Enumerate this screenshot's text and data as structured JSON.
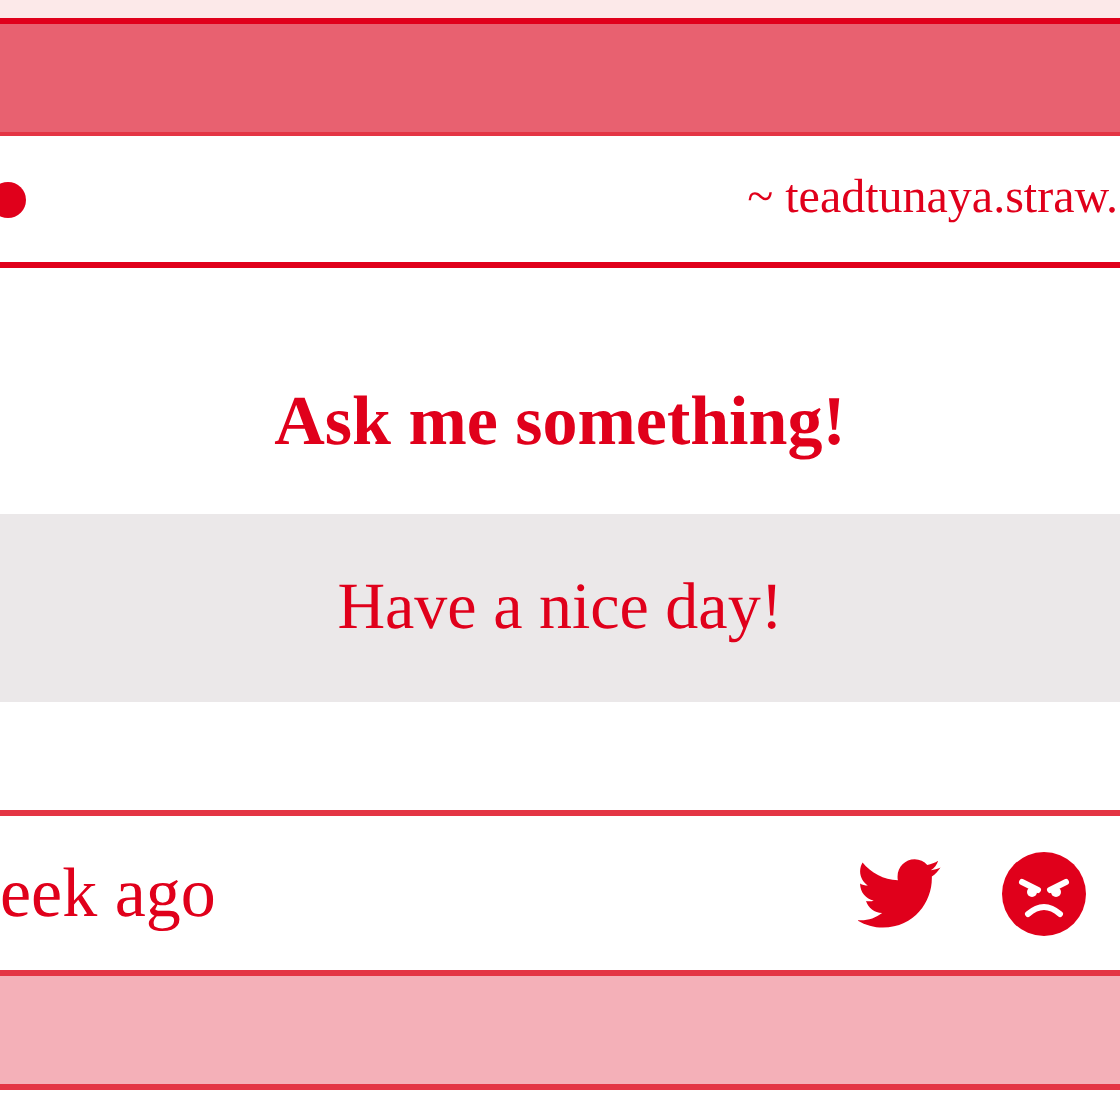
{
  "header": {
    "handle": "~ teadtunaya.straw."
  },
  "question": "Ask me something!",
  "answer": "Have a nice day!",
  "footer": {
    "time": "eek ago"
  }
}
